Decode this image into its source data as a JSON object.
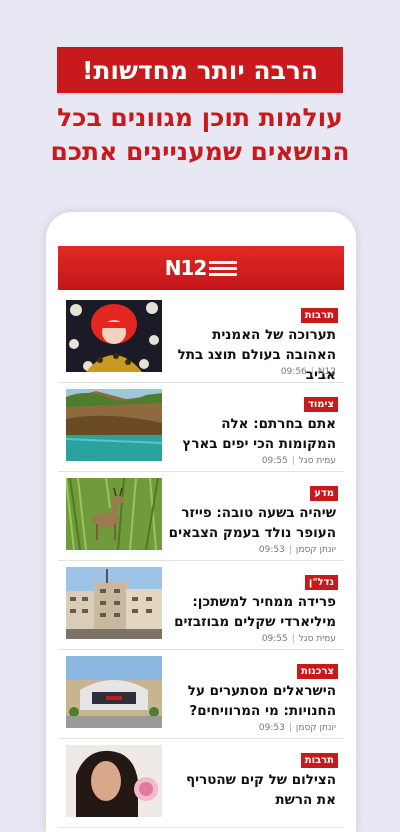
{
  "promo": {
    "headline": "הרבה יותר מחדשות!",
    "subline_1": "עולמות תוכן מגוונים בכל",
    "subline_2": "הנושאים שמעניינים אתכם"
  },
  "app": {
    "logo_text": "N12"
  },
  "articles": [
    {
      "category": "תרבות",
      "title": "תערוכה של האמנית האהובה בעולם תוצג בתל אביב",
      "author": "N12",
      "time": "09:56",
      "image_icon": "artist-photo"
    },
    {
      "category": "צימוד",
      "title": "אתם בחרתם: אלה המקומות הכי יפים בארץ",
      "author": "עמית סגל",
      "time": "09:55",
      "image_icon": "landscape-photo"
    },
    {
      "category": "מדע",
      "title": "שיהיה בשעה טובה: פייזר העופר נולד בעמק הצבאים",
      "author": "יונתן קסמן",
      "time": "09:53",
      "image_icon": "deer-photo"
    },
    {
      "category": "נדל\"ן",
      "title": "פרידה ממחיר למשתכן: מיליארדי שקלים מבוזבזים",
      "author": "עמית סגל",
      "time": "09:55",
      "image_icon": "buildings-photo"
    },
    {
      "category": "צרכנות",
      "title": "הישראלים מסתערים על החנויות: מי המרוויחים?",
      "author": "יונתן קסמן",
      "time": "09:53",
      "image_icon": "mall-photo"
    },
    {
      "category": "תרבות",
      "title": "הצילום של קים שהטריף את הרשת",
      "author": "",
      "time": "",
      "image_icon": "portrait-photo"
    }
  ],
  "colors": {
    "brand_red": "#c8191c",
    "background": "#e7e8f3"
  }
}
